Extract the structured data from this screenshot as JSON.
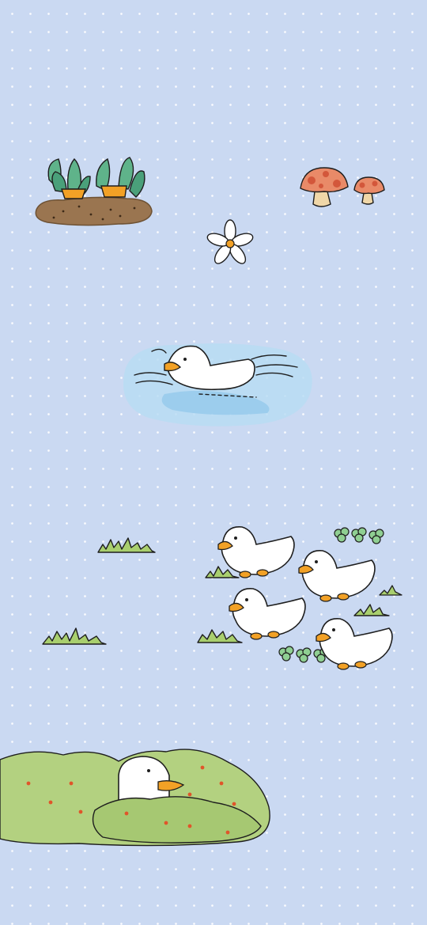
{
  "wallpaper": {
    "background_color": "#cad9f2",
    "dot_color": "#ffffff",
    "elements": [
      "carrot-patch-illustration",
      "mushroom-pair-illustration",
      "daisy-flower-illustration",
      "swimming-duck-illustration",
      "duck-flock-illustration",
      "grass-tuft-illustration",
      "clover-illustration",
      "duck-in-bush-illustration"
    ]
  },
  "palette": {
    "duck_white": "#ffffff",
    "beak_orange": "#f2a126",
    "outline": "#1e1e1e",
    "water_blue": "#a9d3ef",
    "grass_green": "#a9cf6e",
    "bush_green": "#b3d180",
    "berry_red": "#e0552a",
    "mushroom_red": "#e98a68",
    "soil_brown": "#8a6a47",
    "leaf_green": "#5fb38a"
  }
}
